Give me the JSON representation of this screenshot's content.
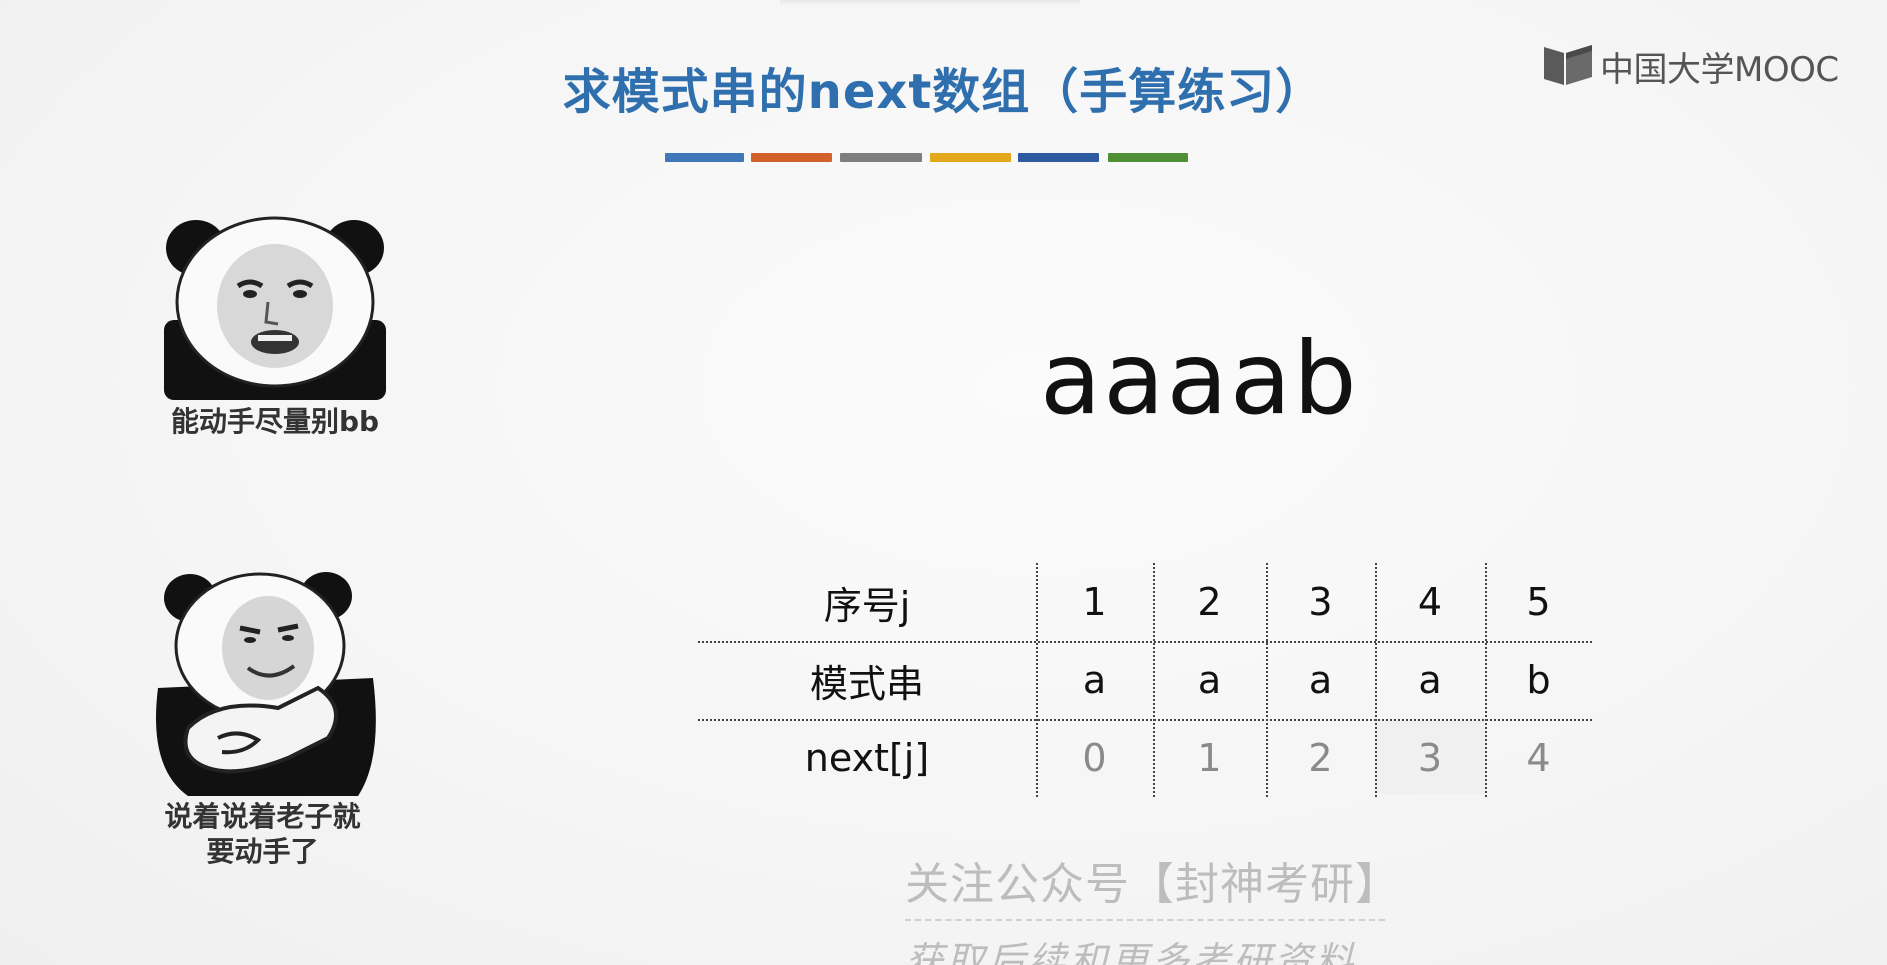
{
  "slide": {
    "title": "求模式串的next数组（手算练习）",
    "pattern": "aaaab",
    "color_bars": [
      "#3f78b8",
      "#d2612c",
      "#7e7e7e",
      "#e3a71b",
      "#2e5aa0",
      "#4f8f35"
    ]
  },
  "logo": {
    "text": "中国大学MOOC",
    "icon": "book-icon"
  },
  "memes": [
    {
      "caption": "能动手尽量别bb"
    },
    {
      "caption_line1": "说着说着老子就",
      "caption_line2": "要动手了"
    }
  ],
  "table": {
    "row_labels": [
      "序号j",
      "模式串",
      "next[j]"
    ],
    "j": [
      "1",
      "2",
      "3",
      "4",
      "5"
    ],
    "pattern": [
      "a",
      "a",
      "a",
      "a",
      "b"
    ],
    "next": [
      "0",
      "1",
      "2",
      "3",
      "4"
    ]
  },
  "watermark": {
    "line1": "关注公众号【封神考研】",
    "line2": "获取后续和更多考研资料"
  }
}
